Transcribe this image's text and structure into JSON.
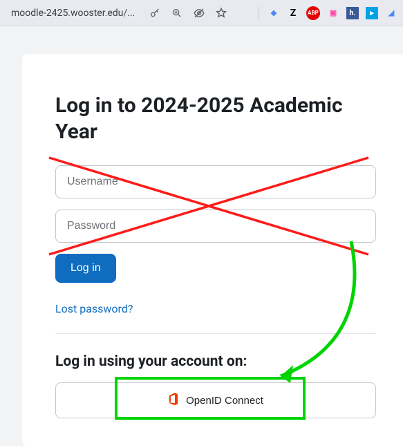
{
  "browser": {
    "url": "moodle-2425.wooster.edu/..."
  },
  "page": {
    "heading": "Log in to 2024-2025 Academic Year",
    "username_placeholder": "Username",
    "password_placeholder": "Password",
    "login_button": "Log in",
    "lost_password": "Lost password?",
    "subheading": "Log in using your account on:",
    "openid_button": "OpenID Connect"
  },
  "icons": {
    "office": "office-icon",
    "key": "key-icon",
    "zoom": "zoom-icon",
    "eye_off": "eye-off-icon",
    "star": "star-icon"
  },
  "colors": {
    "primary": "#0f6cbf",
    "annotation_red": "#ff1a1a",
    "annotation_green": "#00d400",
    "office_orange": "#eb3c00"
  }
}
